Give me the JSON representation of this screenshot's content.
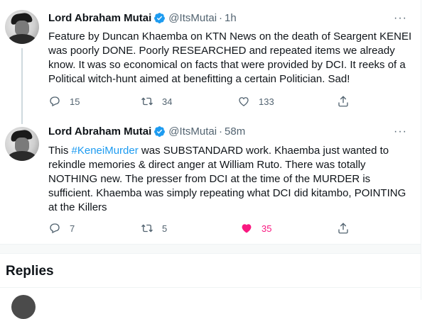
{
  "tweets": [
    {
      "name": "Lord Abraham Mutai",
      "handle": "@ItsMutai",
      "time": "1h",
      "lines": [
        "Feature by Duncan Khaemba on KTN News on the death of Seargent KENEI",
        "was poorly DONE. Poorly RESEARCHED and repeated items we already",
        "know. It was so economical on facts that were provided by DCI. It reeks of a",
        "Political witch-hunt aimed at benefitting a certain Politician. Sad!"
      ],
      "replies": "15",
      "retweets": "34",
      "likes": "133",
      "liked": false
    },
    {
      "name": "Lord Abraham Mutai",
      "handle": "@ItsMutai",
      "time": "58m",
      "hashtag": "#KeneiMurder",
      "line1_before": "This ",
      "line1_after": " was SUBSTANDARD work. Khaemba just wanted to",
      "lines": [
        "rekindle memories & direct anger at William Ruto. There was totally",
        "NOTHING new. The presser from DCI at the time of the MURDER is",
        "sufficient. Khaemba was simply repeating what DCI did kitambo, POINTING",
        "at the Killers"
      ],
      "replies": "7",
      "retweets": "5",
      "likes": "35",
      "liked": true
    }
  ],
  "separator": "·",
  "more_label": "···",
  "section_title": "Replies",
  "colors": {
    "accent": "#1d9bf0",
    "like": "#f91880",
    "muted": "#536471"
  },
  "icons": [
    "verified-badge-icon",
    "more-icon",
    "reply-icon",
    "retweet-icon",
    "like-icon",
    "share-icon"
  ]
}
